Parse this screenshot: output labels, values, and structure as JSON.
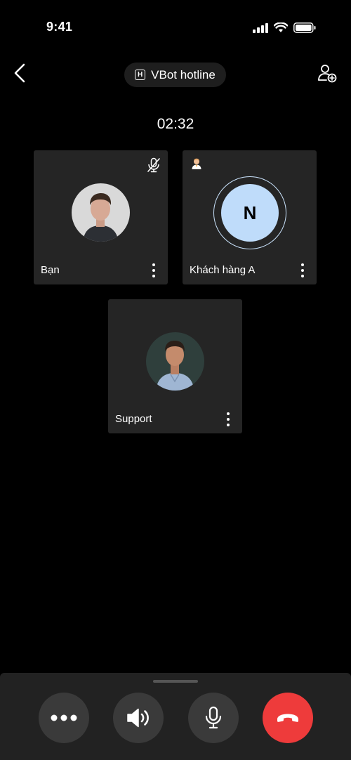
{
  "status_bar": {
    "time": "9:41"
  },
  "header": {
    "title": "VBot hotline",
    "title_badge": "H"
  },
  "call": {
    "duration": "02:32"
  },
  "participants": [
    {
      "name": "Bạn",
      "avatar": "photo",
      "muted": true
    },
    {
      "name": "Khách hàng A",
      "avatar_initial": "N",
      "role_icon": "customer-icon"
    },
    {
      "name": "Support",
      "avatar": "photo"
    }
  ],
  "controls": [
    "more-options",
    "speaker",
    "microphone",
    "end-call"
  ],
  "colors": {
    "background": "#000000",
    "tile": "#252525",
    "end_call": "#ee3b3b",
    "avatar_initial_bg": "#bfdcfa"
  }
}
